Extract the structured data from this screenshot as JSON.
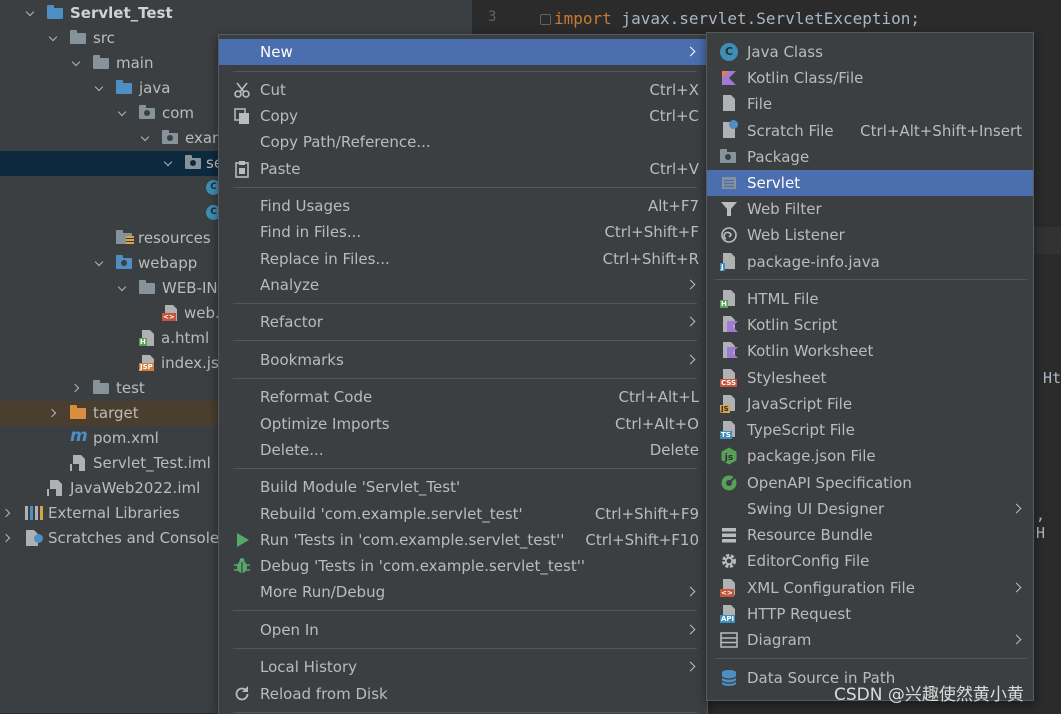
{
  "project_tree": {
    "items": [
      {
        "label": "Servlet_Test",
        "state": "open"
      },
      {
        "label": "src",
        "state": "open"
      },
      {
        "label": "main",
        "state": "open"
      },
      {
        "label": "java",
        "state": "open"
      },
      {
        "label": "com",
        "state": "open"
      },
      {
        "label": "exam",
        "state": "open"
      },
      {
        "label": "se",
        "state": "open",
        "selected": true
      },
      {
        "label": "resources"
      },
      {
        "label": "webapp",
        "state": "open"
      },
      {
        "label": "WEB-INI",
        "state": "open"
      },
      {
        "label": "web."
      },
      {
        "label": "a.html"
      },
      {
        "label": "index.jsp"
      },
      {
        "label": "test",
        "state": "closed"
      },
      {
        "label": "target",
        "state": "closed"
      },
      {
        "label": "pom.xml"
      },
      {
        "label": "Servlet_Test.iml"
      },
      {
        "label": "JavaWeb2022.iml"
      },
      {
        "label": "External Libraries",
        "state": "closed"
      },
      {
        "label": "Scratches and Consoles",
        "state": "closed"
      }
    ]
  },
  "editor": {
    "line_number": "3",
    "code_keyword": "import",
    "code_rest": " javax.servlet.ServletException;",
    "fragment_1": "Ht",
    "fragment_2": ", H"
  },
  "context_menu": {
    "items": [
      {
        "label": "New",
        "highlighted": true,
        "submenu": true
      },
      {
        "label": "Cut",
        "shortcut": "Ctrl+X",
        "icon": "scissors-icon"
      },
      {
        "label": "Copy",
        "shortcut": "Ctrl+C",
        "icon": "copy-icon"
      },
      {
        "label": "Copy Path/Reference..."
      },
      {
        "label": "Paste",
        "shortcut": "Ctrl+V",
        "icon": "clipboard-icon"
      },
      {
        "label": "Find Usages",
        "shortcut": "Alt+F7"
      },
      {
        "label": "Find in Files...",
        "shortcut": "Ctrl+Shift+F"
      },
      {
        "label": "Replace in Files...",
        "shortcut": "Ctrl+Shift+R"
      },
      {
        "label": "Analyze",
        "submenu": true
      },
      {
        "label": "Refactor",
        "submenu": true
      },
      {
        "label": "Bookmarks",
        "submenu": true
      },
      {
        "label": "Reformat Code",
        "shortcut": "Ctrl+Alt+L"
      },
      {
        "label": "Optimize Imports",
        "shortcut": "Ctrl+Alt+O"
      },
      {
        "label": "Delete...",
        "shortcut": "Delete"
      },
      {
        "label": "Build Module 'Servlet_Test'"
      },
      {
        "label": "Rebuild 'com.example.servlet_test'",
        "shortcut": "Ctrl+Shift+F9"
      },
      {
        "label": "Run 'Tests in 'com.example.servlet_test''",
        "shortcut": "Ctrl+Shift+F10",
        "icon": "run-icon"
      },
      {
        "label": "Debug 'Tests in 'com.example.servlet_test''",
        "icon": "debug-icon"
      },
      {
        "label": "More Run/Debug",
        "submenu": true
      },
      {
        "label": "Open In",
        "submenu": true
      },
      {
        "label": "Local History",
        "submenu": true
      },
      {
        "label": "Reload from Disk",
        "icon": "reload-icon"
      }
    ]
  },
  "new_submenu": {
    "items": [
      {
        "label": "Java Class",
        "icon": "java-class-icon"
      },
      {
        "label": "Kotlin Class/File",
        "icon": "kotlin-icon"
      },
      {
        "label": "File",
        "icon": "file-icon"
      },
      {
        "label": "Scratch File",
        "shortcut": "Ctrl+Alt+Shift+Insert",
        "icon": "scratch-file-icon"
      },
      {
        "label": "Package",
        "icon": "package-icon"
      },
      {
        "label": "Servlet",
        "highlighted": true,
        "icon": "servlet-icon"
      },
      {
        "label": "Web Filter",
        "icon": "filter-icon"
      },
      {
        "label": "Web Listener",
        "icon": "listener-icon"
      },
      {
        "label": "package-info.java",
        "icon": "java-file-icon"
      },
      {
        "label": "HTML File",
        "icon": "html-icon"
      },
      {
        "label": "Kotlin Script",
        "icon": "kotlin-script-icon"
      },
      {
        "label": "Kotlin Worksheet",
        "icon": "kotlin-worksheet-icon"
      },
      {
        "label": "Stylesheet",
        "icon": "css-icon"
      },
      {
        "label": "JavaScript File",
        "icon": "js-icon"
      },
      {
        "label": "TypeScript File",
        "icon": "ts-icon"
      },
      {
        "label": "package.json File",
        "icon": "nodejs-icon"
      },
      {
        "label": "OpenAPI Specification",
        "icon": "openapi-icon"
      },
      {
        "label": "Swing UI Designer",
        "submenu": true
      },
      {
        "label": "Resource Bundle",
        "icon": "resource-bundle-icon"
      },
      {
        "label": "EditorConfig File",
        "icon": "gear-icon"
      },
      {
        "label": "XML Configuration File",
        "submenu": true,
        "icon": "xml-icon"
      },
      {
        "label": "HTTP Request",
        "icon": "api-icon"
      },
      {
        "label": "Diagram",
        "submenu": true,
        "icon": "diagram-icon"
      },
      {
        "label": "Data Source in Path",
        "icon": "database-icon"
      }
    ]
  },
  "watermark": "CSDN @兴趣使然黄小黄",
  "colors": {
    "highlight": "#4b6eaf",
    "selected_row": "#0d293e",
    "menu_bg": "#3c3f41",
    "editor_bg": "#2b2b2b"
  }
}
